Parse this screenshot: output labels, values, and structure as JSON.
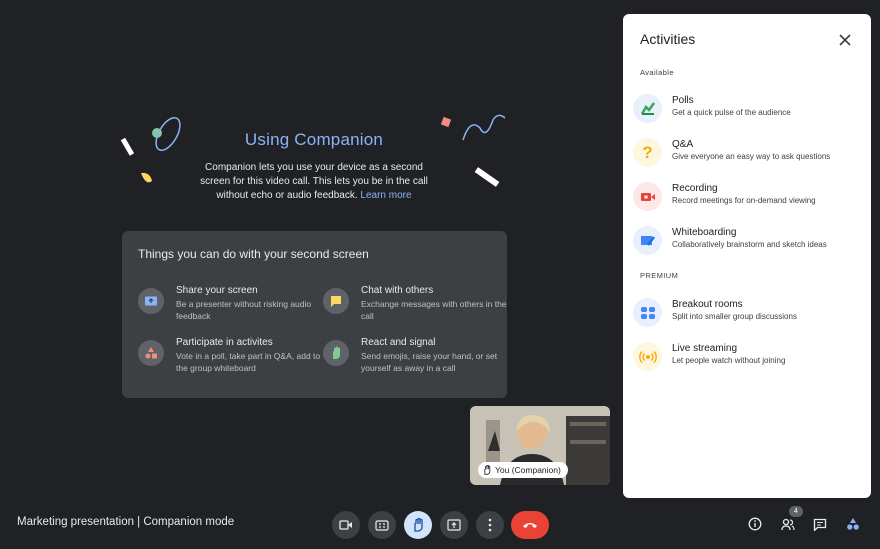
{
  "companion": {
    "title": "Using Companion",
    "description": "Companion lets you use your device as a second screen for this video call. This lets you be in the call without echo or audio feedback.",
    "learn_more": "Learn more"
  },
  "second_screen": {
    "title": "Things you can do with your second screen",
    "features": [
      {
        "title": "Share your screen",
        "desc": "Be a presenter without risking audio feedback",
        "icon": "present-screen-icon"
      },
      {
        "title": "Chat with others",
        "desc": "Exchange messages with others in the call",
        "icon": "chat-icon"
      },
      {
        "title": "Participate in activites",
        "desc": "Vote in a poll, take part in Q&A, add to the group whiteboard",
        "icon": "shapes-icon"
      },
      {
        "title": "React and signal",
        "desc": "Send emojis, raise your hand, or set yourself as away in a call",
        "icon": "raise-hand-icon"
      }
    ]
  },
  "self_view": {
    "label": "You (Companion)"
  },
  "activities_panel": {
    "title": "Activities",
    "available_label": "Available",
    "premium_label": "PREMIUM",
    "available": [
      {
        "title": "Polls",
        "desc": "Get a quick pulse of the audience",
        "icon": "poll-icon"
      },
      {
        "title": "Q&A",
        "desc": "Give everyone an easy way to ask questions",
        "icon": "question-icon"
      },
      {
        "title": "Recording",
        "desc": "Record meetings for on-demand viewing",
        "icon": "recording-icon"
      },
      {
        "title": "Whiteboarding",
        "desc": "Collaboratively brainstorm and sketch ideas",
        "icon": "whiteboard-icon"
      }
    ],
    "premium": [
      {
        "title": "Breakout rooms",
        "desc": "Split into smaller group discussions",
        "icon": "breakout-rooms-icon"
      },
      {
        "title": "Live streaming",
        "desc": "Let people watch without joining",
        "icon": "live-stream-icon"
      }
    ]
  },
  "bottom_bar": {
    "meeting_title": "Marketing presentation | Companion mode",
    "participant_count": "4"
  },
  "colors": {
    "background": "#202124",
    "accent_blue": "#8ab4f8",
    "end_call_red": "#ea4335",
    "card": "#3c4043"
  }
}
